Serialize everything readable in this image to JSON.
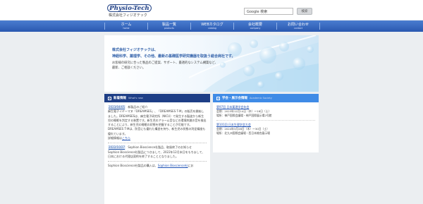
{
  "header": {
    "logo_text": "Physio-Tech",
    "company_name": "株式会社フィジオテック",
    "search": {
      "label": "Google 検索",
      "button": "検索"
    }
  },
  "nav": [
    {
      "label": "ホーム",
      "sub": "home"
    },
    {
      "label": "製品一覧",
      "sub": "products"
    },
    {
      "label": "WEBカタログ",
      "sub": "catalog"
    },
    {
      "label": "会社概要",
      "sub": "company"
    },
    {
      "label": "お問い合わせ",
      "sub": "contact"
    }
  ],
  "hero": {
    "title": "株式会社フィジオテックは、",
    "subtitle": "神経科学、薬理学、その他、最新の基礎医学研究機器を取扱う総合商社です。",
    "body_line1": "お客様の研究に合った製品のご提案、サポート、最適的なシステム構築など、",
    "body_line2": "最新、ご相談ください。"
  },
  "news": {
    "header_jp": "新着情報",
    "header_en": "What's new",
    "items": [
      {
        "date": "2023/04/05",
        "title": "新製品のご紹介",
        "body": "麻生電子イヤーマヌ「DREAMSES」、「DREAMSES T-M」の販売を開始しました。DREAMSESは、麻生電子研究所（NICU）で発生する脳波から新生児の睡眠を判定する装置です。新生児のアラーム音などの環境刺激の音を検出することにより、新生児の睡眠の状態を把握することが可能です。DREAMSES T-Mは、防音にも優れた構造を持ち、新生児の状態の判定精度も優れています。",
        "link_prefix": "詳細情報は",
        "link": "こちら"
      },
      {
        "date": "2022/10/27",
        "title": "Sophion Bioscience社製品、取扱終了のお知らせ",
        "body": "Sophion Bioscience社製品につきまして、2022年12月末日をもちまして、日本における代理店契約を終了することとなりました。"
      },
      {
        "date": "",
        "title": "Sophion Bioscience社製品の購入は、",
        "link": "Sophion Bioscience社",
        "suffix": "にお"
      }
    ]
  },
  "events": {
    "header_jp": "学会・展示会情報",
    "header_en": "Academic Society",
    "items": [
      {
        "title": "第97回 日本薬理学会年会",
        "date": "会期：2023年12月14日（木）～16日（土）",
        "venue": "場所：神戸国際会議場・神戸国際展示場2号館"
      },
      {
        "title": "第101回 日本生理学会大会",
        "date": "会期：2024年3月28日（木）～30日（土）",
        "venue": "場所：北九州国際会議場・西日本総合展示場"
      }
    ]
  },
  "colors": {
    "nav_bar": "#2f5fb5",
    "news_header": "#1e3e86",
    "events_header": "#3f8be6",
    "page_bg": "#ebeef1"
  }
}
